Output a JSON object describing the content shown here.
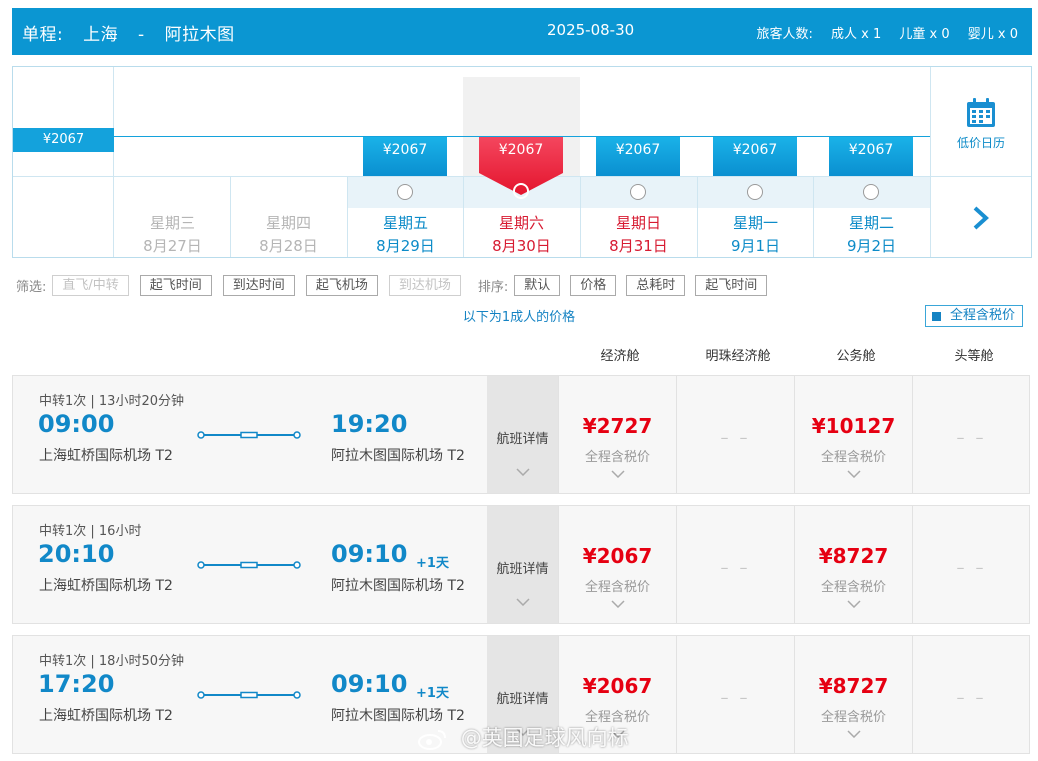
{
  "header": {
    "trip_type": "单程:",
    "origin": "上海",
    "separator": "-",
    "destination": "阿拉木图",
    "date": "2025-08-30",
    "pax_label": "旅客人数:",
    "adult": "成人 x 1",
    "child": "儿童 x 0",
    "infant": "婴儿 x 0"
  },
  "calendar": {
    "left_price": "¥2067",
    "side_label": "低价日历",
    "days": [
      {
        "weekday": "星期三",
        "date": "8月27日",
        "price": "",
        "state": "past"
      },
      {
        "weekday": "星期四",
        "date": "8月28日",
        "price": "",
        "state": "past"
      },
      {
        "weekday": "星期五",
        "date": "8月29日",
        "price": "¥2067",
        "state": "blue"
      },
      {
        "weekday": "星期六",
        "date": "8月30日",
        "price": "¥2067",
        "state": "selected"
      },
      {
        "weekday": "星期日",
        "date": "8月31日",
        "price": "¥2067",
        "state": "red"
      },
      {
        "weekday": "星期一",
        "date": "9月1日",
        "price": "¥2067",
        "state": "blue"
      },
      {
        "weekday": "星期二",
        "date": "9月2日",
        "price": "¥2067",
        "state": "blue"
      }
    ]
  },
  "filters": {
    "label": "筛选:",
    "items": [
      {
        "label": "直飞/中转",
        "disabled": true
      },
      {
        "label": "起飞时间",
        "disabled": false
      },
      {
        "label": "到达时间",
        "disabled": false
      },
      {
        "label": "起飞机场",
        "disabled": false
      },
      {
        "label": "到达机场",
        "disabled": true
      }
    ],
    "sort_label": "排序:",
    "sort_items": [
      "默认",
      "价格",
      "总耗时",
      "起飞时间"
    ]
  },
  "price_note": "以下为1成人的价格",
  "tax_toggle": "全程含税价",
  "cabins": [
    "经济舱",
    "明珠经济舱",
    "公务舱",
    "头等舱"
  ],
  "flights": [
    {
      "transfer": "中转1次 | 13小时20分钟",
      "dep_time": "09:00",
      "dep_airport": "上海虹桥国际机场 T2",
      "arr_time": "19:20",
      "arr_airport": "阿拉木图国际机场 T2",
      "plus_day": "",
      "detail": "航班详情",
      "economy": "¥2727",
      "premium": "– –",
      "business": "¥10127",
      "first": "– –",
      "tax_label": "全程含税价"
    },
    {
      "transfer": "中转1次 | 16小时",
      "dep_time": "20:10",
      "dep_airport": "上海虹桥国际机场 T2",
      "arr_time": "09:10",
      "arr_airport": "阿拉木图国际机场 T2",
      "plus_day": "+1天",
      "detail": "航班详情",
      "economy": "¥2067",
      "premium": "– –",
      "business": "¥8727",
      "first": "– –",
      "tax_label": "全程含税价"
    },
    {
      "transfer": "中转1次 | 18小时50分钟",
      "dep_time": "17:20",
      "dep_airport": "上海虹桥国际机场 T2",
      "arr_time": "09:10",
      "arr_airport": "阿拉木图国际机场 T2",
      "plus_day": "+1天",
      "detail": "航班详情",
      "economy": "¥2067",
      "premium": "– –",
      "business": "¥8727",
      "first": "– –",
      "tax_label": "全程含税价"
    }
  ],
  "watermark": "@英国足球风向标",
  "colors": {
    "brand": "#0b96d2",
    "price_red": "#e60012",
    "link_blue": "#1583c3"
  }
}
